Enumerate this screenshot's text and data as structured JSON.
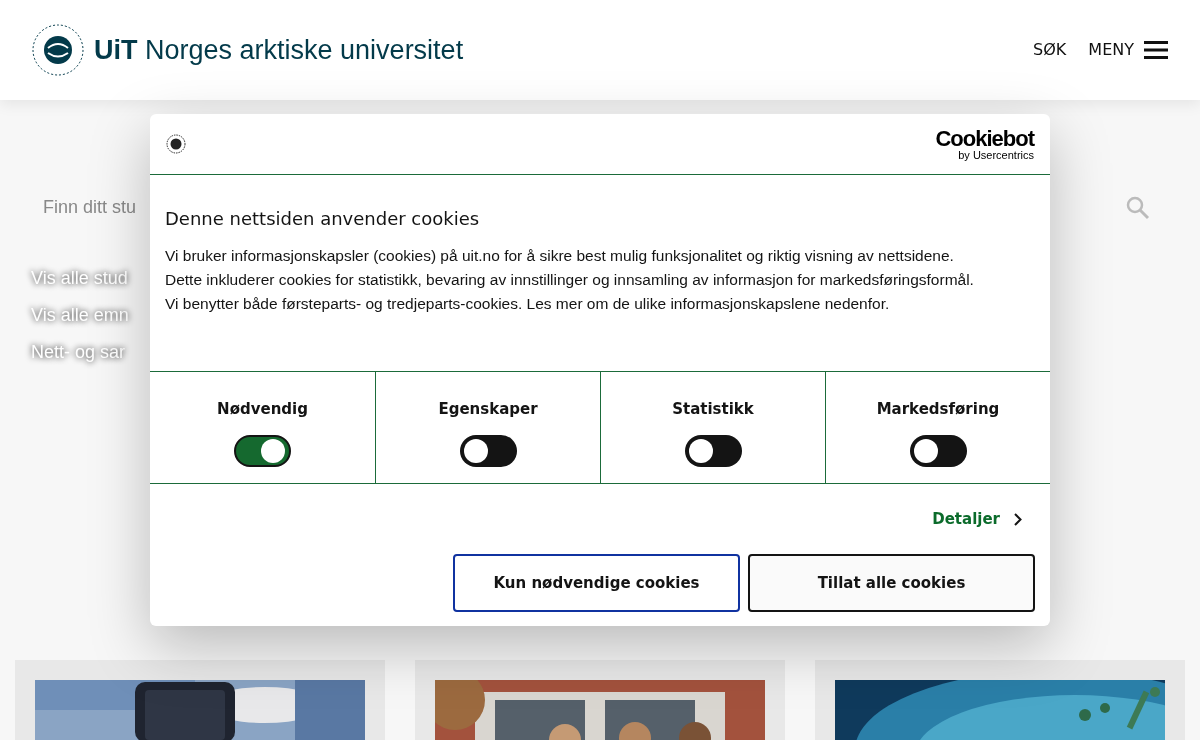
{
  "header": {
    "brand_bold": "UiT",
    "brand": "Norges arktiske universitet",
    "search_label": "SØK",
    "menu_label": "MENY"
  },
  "search": {
    "placeholder": "Finn ditt stu"
  },
  "links": [
    "Vis alle stud",
    "Vis alle emn",
    "Nett- og sar"
  ],
  "cards": [
    {
      "kind": "picture"
    },
    {
      "kind": "picture"
    },
    {
      "kind": "picture"
    }
  ],
  "dialog": {
    "brand": "Cookiebot",
    "brand_sub": "by Usercentrics",
    "title": "Denne nettsiden anvender cookies",
    "text": "Vi bruker informasjonskapsler (cookies) på uit.no for å sikre best mulig funksjonalitet og riktig visning av nettsidene. Dette inkluderer cookies for statistikk, bevaring av innstillinger og innsamling av informasjon for markedsføringsformål. Vi benytter både førsteparts- og tredjeparts-cookies. Les mer om de ulike informasjonskapslene nedenfor.",
    "categories": [
      {
        "label": "Nødvendig",
        "on": true
      },
      {
        "label": "Egenskaper",
        "on": false
      },
      {
        "label": "Statistikk",
        "on": false
      },
      {
        "label": "Markedsføring",
        "on": false
      }
    ],
    "details_link": "Detaljer",
    "buttons": [
      "Kun nødvendige cookies",
      "Tillat alle cookies"
    ]
  }
}
